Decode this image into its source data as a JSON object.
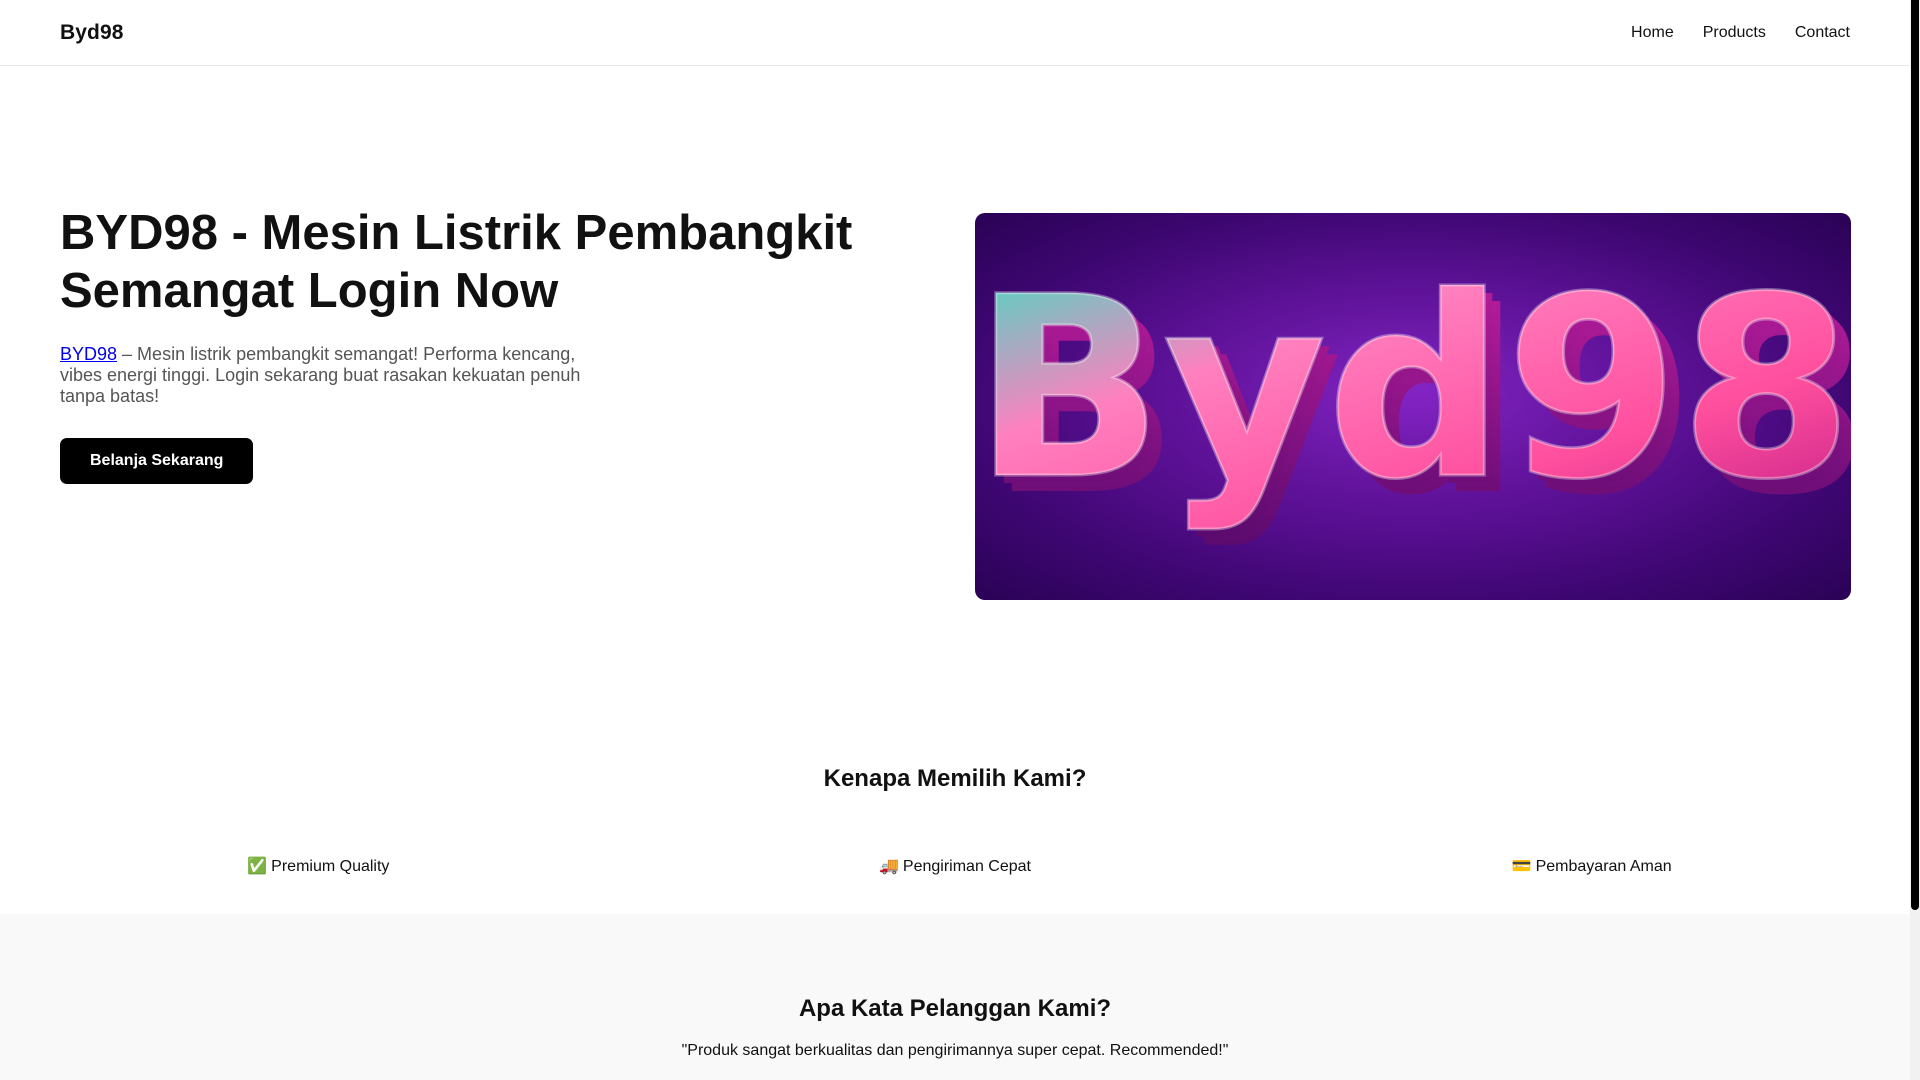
{
  "navbar": {
    "brand": "Byd98",
    "links": [
      "Home",
      "Products",
      "Contact"
    ]
  },
  "hero": {
    "title": "BYD98 - Mesin Listrik Pembangkit Semangat Login Now",
    "desc_link": "BYD98",
    "desc_text": " – Mesin listrik pembangkit semangat! Performa kencang, vibes energi tinggi. Login sekarang buat rasakan kekuatan penuh tanpa batas!",
    "cta_label": "Belanja Sekarang",
    "image_logo_text": "Byd98"
  },
  "features": {
    "title": "Kenapa Memilih Kami?",
    "items": [
      {
        "icon": "✅",
        "icon_name": "check-mark-icon",
        "label": "Premium Quality"
      },
      {
        "icon": "🚚",
        "icon_name": "delivery-truck-icon",
        "label": "Pengiriman Cepat"
      },
      {
        "icon": "💳",
        "icon_name": "credit-card-icon",
        "label": "Pembayaran Aman"
      }
    ]
  },
  "testimonials": {
    "title": "Apa Kata Pelanggan Kami?",
    "quote": "\"Produk sangat berkualitas dan pengirimannya super cepat. Recommended!\""
  },
  "colors": {
    "accent": "#000000",
    "link": "#0000ee",
    "hero_bg": "#5a0d94",
    "logo_pink": "#ff5fa8",
    "logo_teal": "#2fe6c4"
  }
}
